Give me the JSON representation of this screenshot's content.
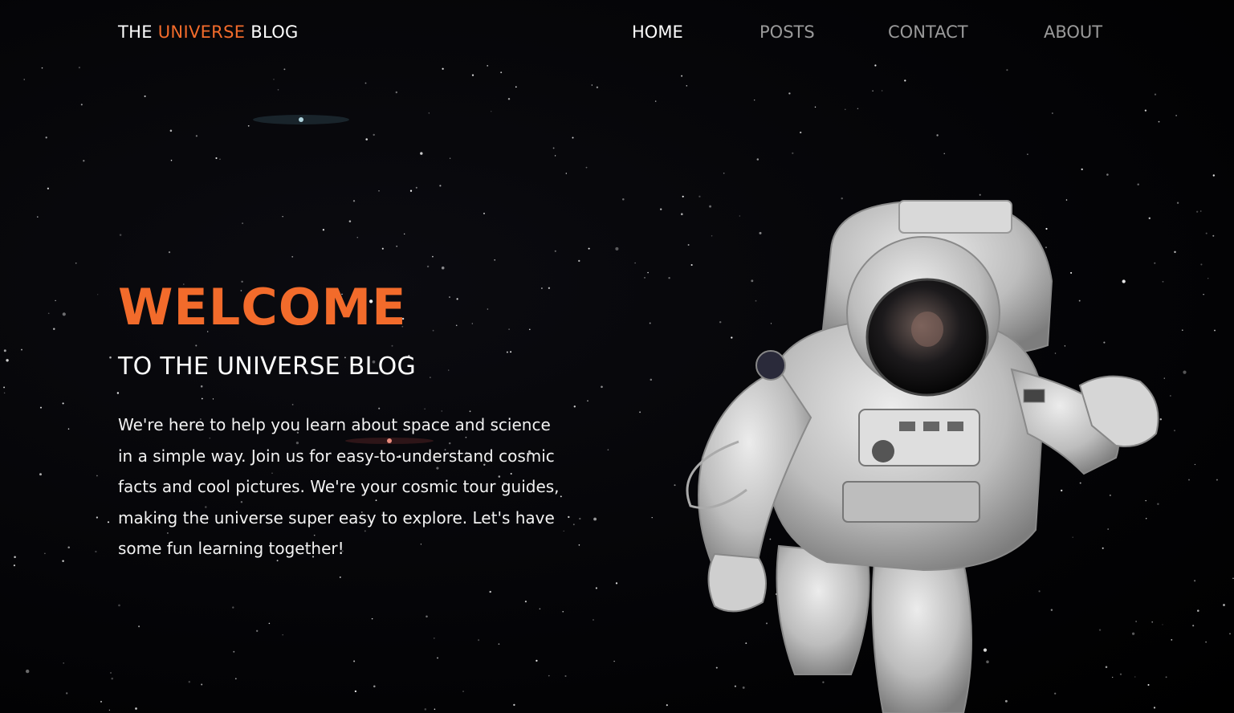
{
  "brand": {
    "prefix": "THE ",
    "accent": "UNIVERSE",
    "suffix": " BLOG",
    "accent_color": "#f26b2b"
  },
  "nav": {
    "items": [
      {
        "label": "HOME",
        "active": true
      },
      {
        "label": "POSTS",
        "active": false
      },
      {
        "label": "CONTACT",
        "active": false
      },
      {
        "label": "ABOUT",
        "active": false
      }
    ]
  },
  "hero": {
    "title": "WELCOME",
    "subtitle": "TO THE UNIVERSE BLOG",
    "body": "We're here to help you learn about space and science in a simple way. Join us for easy-to-understand cosmic facts and cool pictures. We're your cosmic tour guides, making the universe super easy to explore. Let's have some fun learning together!",
    "image_icon": "astronaut-image"
  },
  "colors": {
    "background": "#050507",
    "accent": "#f26b2b",
    "nav_inactive": "#9a9a9a",
    "text": "#ffffff"
  }
}
